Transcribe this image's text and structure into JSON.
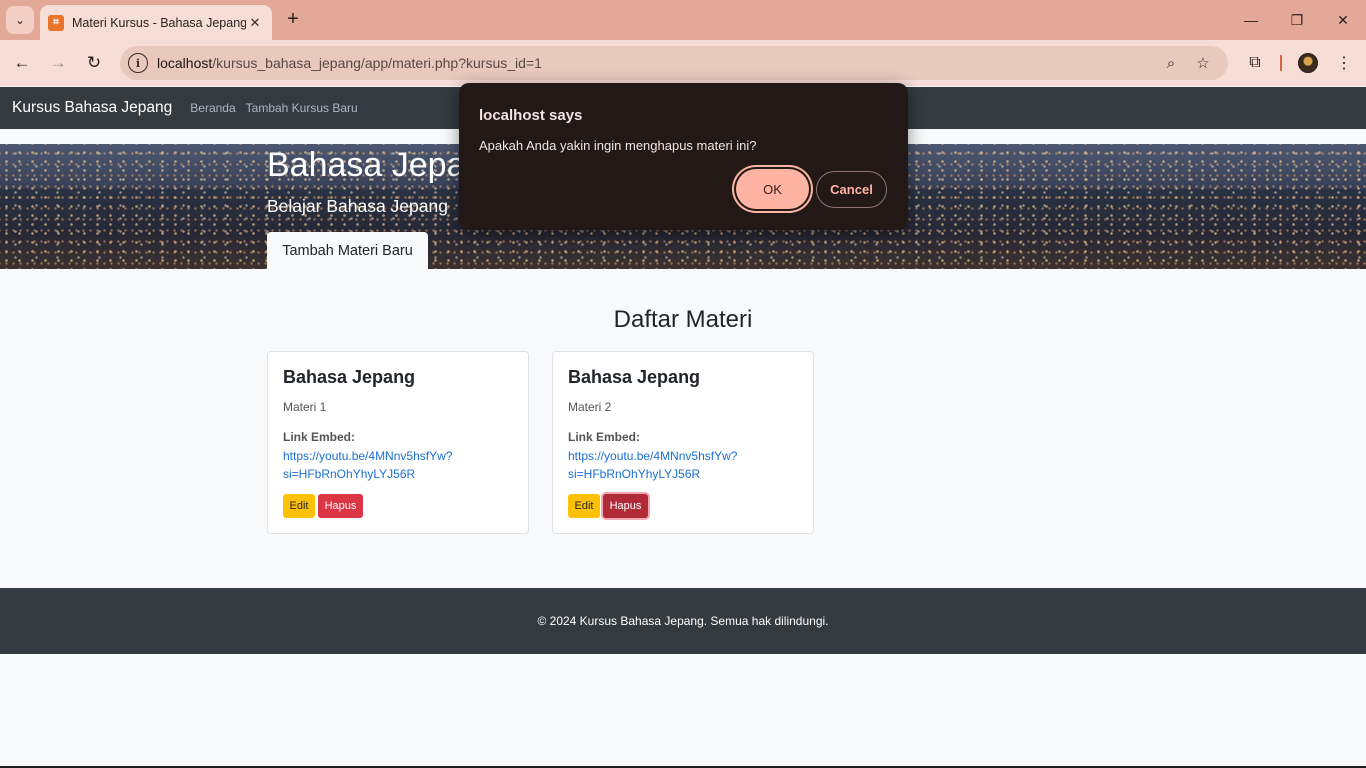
{
  "browser": {
    "tab_title": "Materi Kursus - Bahasa Jepang",
    "url_host": "localhost",
    "url_path": "/kursus_bahasa_jepang/app/materi.php?kursus_id=1",
    "icons": [
      "tab-search-icon",
      "favicon-icon",
      "tab-close-icon",
      "new-tab-icon",
      "minimize-icon",
      "restore-icon",
      "close-window-icon",
      "back-icon",
      "forward-icon",
      "reload-icon",
      "site-info-icon",
      "zoom-icon",
      "bookmark-star-icon",
      "extensions-icon",
      "profile-avatar",
      "menu-icon"
    ]
  },
  "navbar": {
    "brand": "Kursus Bahasa Jepang",
    "links": [
      "Beranda",
      "Tambah Kursus Baru"
    ]
  },
  "hero": {
    "title": "Bahasa Jepang",
    "subtitle": "Belajar Bahasa Jepang",
    "button": "Tambah Materi Baru"
  },
  "main": {
    "section_title": "Daftar Materi",
    "cards": [
      {
        "title": "Bahasa Jepang",
        "subtitle": "Materi 1",
        "link_label": "Link Embed:",
        "link": "https://youtu.be/4MNnv5hsfYw?si=HFbRnOhYhyLYJ56R",
        "edit": "Edit",
        "delete": "Hapus"
      },
      {
        "title": "Bahasa Jepang",
        "subtitle": "Materi 2",
        "link_label": "Link Embed:",
        "link": "https://youtu.be/4MNnv5hsfYw?si=HFbRnOhYhyLYJ56R",
        "edit": "Edit",
        "delete": "Hapus"
      }
    ]
  },
  "footer": {
    "text": "© 2024 Kursus Bahasa Jepang. Semua hak dilindungi."
  },
  "dialog": {
    "title": "localhost says",
    "message": "Apakah Anda yakin ingin menghapus materi ini?",
    "ok": "OK",
    "cancel": "Cancel"
  },
  "colors": {
    "chrome_titlebar": "#e3a898",
    "chrome_toolbar": "#f6ddd6",
    "navbar": "#343a40",
    "edit_button": "#ffc107",
    "delete_button": "#dc3545",
    "link": "#1a6fd4",
    "dialog_bg": "#221816",
    "dialog_accent": "#ffb4a3"
  }
}
